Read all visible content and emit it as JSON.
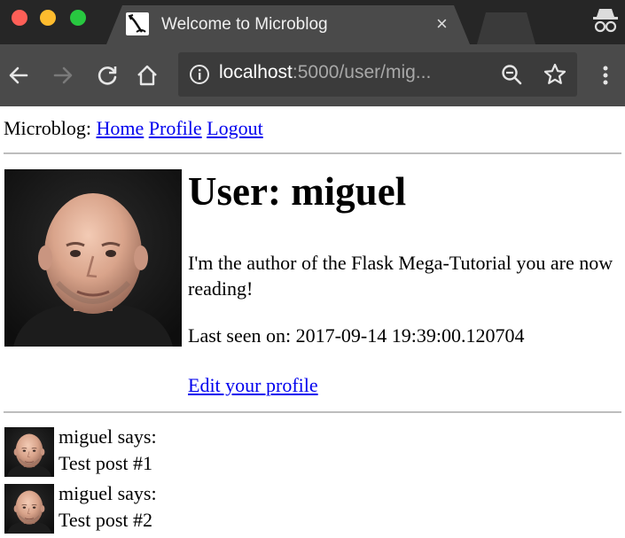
{
  "browser": {
    "tab_title": "Welcome to Microblog",
    "tab_close": "×",
    "url_host": "localhost",
    "url_rest": ":5000/user/mig...",
    "icons": [
      "back-icon",
      "forward-icon",
      "reload-icon",
      "home-icon",
      "info-icon",
      "zoom-icon",
      "bookmark-star-icon",
      "menu-icon",
      "incognito-icon"
    ]
  },
  "nav": {
    "brand": "Microblog:",
    "links": [
      "Home",
      "Profile",
      "Logout"
    ]
  },
  "profile": {
    "heading": "User: miguel",
    "about_me": "I'm the author of the Flask Mega-Tutorial you are now reading!",
    "last_seen": "Last seen on: 2017-09-14 19:39:00.120704",
    "edit_link": "Edit your profile"
  },
  "posts": [
    {
      "author": "miguel says:",
      "body": "Test post #1"
    },
    {
      "author": "miguel says:",
      "body": "Test post #2"
    }
  ],
  "colors": {
    "link": "#0000ee",
    "chrome_dark": "#262626",
    "chrome_toolbar": "#4a4a4a"
  }
}
